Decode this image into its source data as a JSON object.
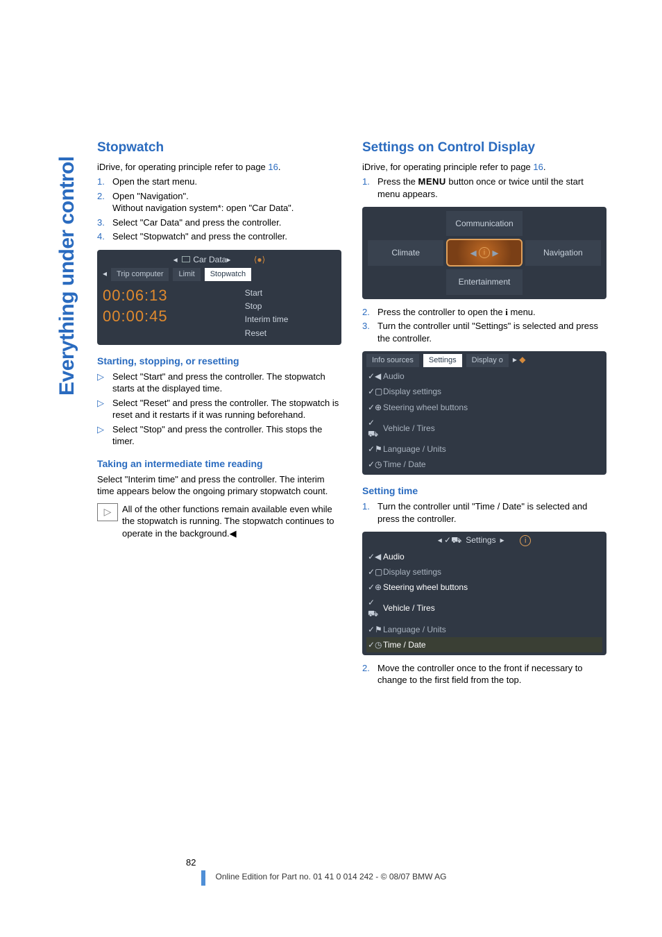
{
  "side_label": "Everything under control",
  "left": {
    "h2": "Stopwatch",
    "intro_a": "iDrive, for operating principle refer to page ",
    "intro_link": "16",
    "intro_b": ".",
    "steps": [
      {
        "n": "1.",
        "t": "Open the start menu."
      },
      {
        "n": "2.",
        "t": "Open \"Navigation\".",
        "t2": "Without navigation system*: open \"Car Data\"."
      },
      {
        "n": "3.",
        "t": "Select \"Car Data\" and press the controller."
      },
      {
        "n": "4.",
        "t": "Select \"Stopwatch\" and press the controller."
      }
    ],
    "shot1": {
      "hdr": "Car Data",
      "tabs": [
        "Trip computer",
        "Limit",
        "Stopwatch"
      ],
      "time1": "00:06:13",
      "time2": "00:00:45",
      "opts": [
        "Start",
        "Stop",
        "Interim time",
        "Reset"
      ]
    },
    "sub1": "Starting, stopping, or resetting",
    "bul": [
      "Select \"Start\" and press the controller. The stopwatch starts at the displayed time.",
      "Select \"Reset\" and press the controller. The stopwatch is reset and it restarts if it was running beforehand.",
      "Select \"Stop\" and press the controller. This stops the timer."
    ],
    "sub2": "Taking an intermediate time reading",
    "p2": "Select \"Interim time\" and press the controller. The interim time appears below the ongoing primary stopwatch count.",
    "note": "All of the other functions remain available even while the stopwatch is running. The stopwatch continues to operate in the background.",
    "endmark": "◀"
  },
  "right": {
    "h2": "Settings on Control Display",
    "intro_a": "iDrive, for operating principle refer to page ",
    "intro_link": "16",
    "intro_b": ".",
    "step1n": "1.",
    "step1a": "Press the ",
    "step1menu": "MENU",
    "step1b": " button once or twice until the start menu appears.",
    "menu": {
      "top": "Communication",
      "left": "Climate",
      "right": "Navigation",
      "bottom": "Entertainment"
    },
    "step2n": "2.",
    "step2a": "Press the controller to open the ",
    "step2i": "i",
    "step2b": " menu.",
    "step3n": "3.",
    "step3": "Turn the controller until \"Settings\" is selected and press the controller.",
    "shot2": {
      "tabs": [
        "Info sources",
        "Settings",
        "Display o"
      ],
      "rows": [
        "Audio",
        "Display settings",
        "Steering wheel buttons",
        "Vehicle / Tires",
        "Language / Units",
        "Time / Date"
      ]
    },
    "sub1": "Setting time",
    "st1n": "1.",
    "st1": "Turn the controller until \"Time / Date\" is selected and press the controller.",
    "shot3": {
      "hdr": "Settings",
      "rows": [
        "Audio",
        "Display settings",
        "Steering wheel buttons",
        "Vehicle / Tires",
        "Language / Units",
        "Time / Date"
      ]
    },
    "st2n": "2.",
    "st2": "Move the controller once to the front if necessary to change to the first field from the top."
  },
  "footer": {
    "page": "82",
    "line": "Online Edition for Part no. 01 41 0 014 242 - © 08/07 BMW AG"
  }
}
